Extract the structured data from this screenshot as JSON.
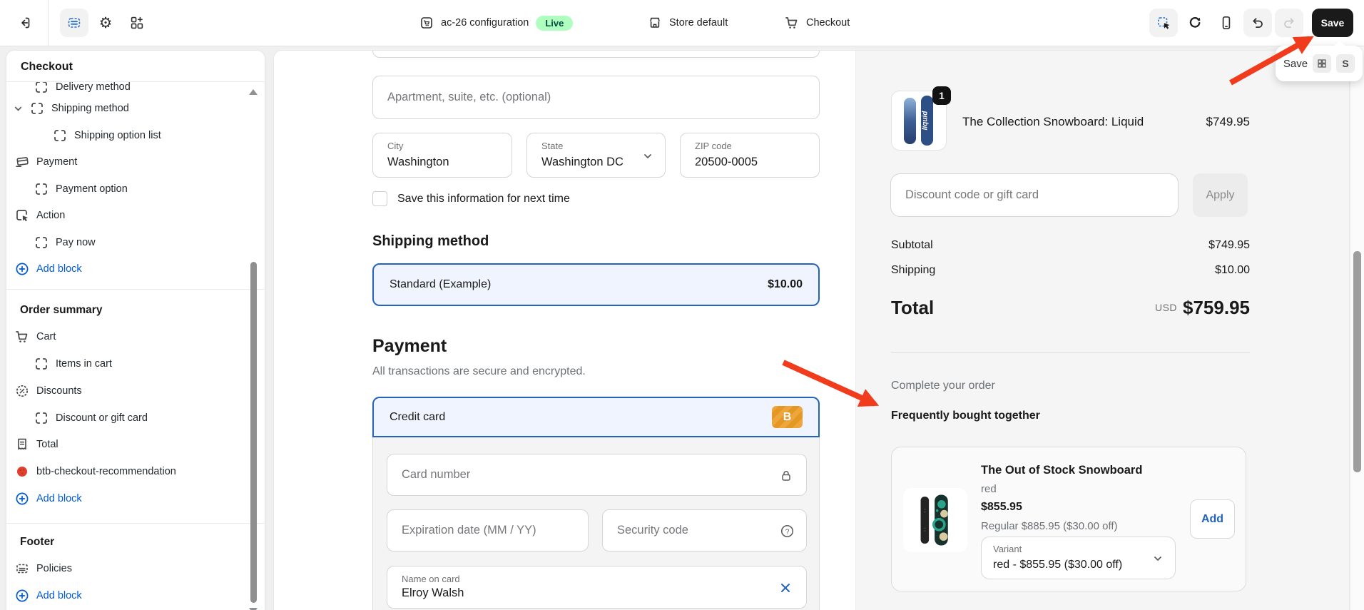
{
  "topbar": {
    "config_label": "ac-26 configuration",
    "live_badge": "Live",
    "store_label": "Store default",
    "page_label": "Checkout",
    "save_label": "Save"
  },
  "save_tooltip": {
    "label": "Save",
    "shortcut_key": "S"
  },
  "sidebar": {
    "title": "Checkout",
    "items": [
      {
        "label": "Delivery method"
      },
      {
        "label": "Shipping method"
      },
      {
        "label": "Shipping option list"
      },
      {
        "label": "Payment"
      },
      {
        "label": "Payment option"
      },
      {
        "label": "Action"
      },
      {
        "label": "Pay now"
      },
      {
        "label": "Add block"
      },
      {
        "label": "Order summary"
      },
      {
        "label": "Cart"
      },
      {
        "label": "Items in cart"
      },
      {
        "label": "Discounts"
      },
      {
        "label": "Discount or gift card"
      },
      {
        "label": "Total"
      },
      {
        "label": "btb-checkout-recommendation"
      },
      {
        "label": "Add block"
      },
      {
        "label": "Footer"
      },
      {
        "label": "Policies"
      },
      {
        "label": "Add block"
      }
    ]
  },
  "checkout_form": {
    "apartment_placeholder": "Apartment, suite, etc. (optional)",
    "city_label": "City",
    "city_value": "Washington",
    "state_label": "State",
    "state_value": "Washington DC",
    "zip_label": "ZIP code",
    "zip_value": "20500-0005",
    "save_info_label": "Save this information for next time",
    "shipping_heading": "Shipping method",
    "shipping_option_name": "Standard (Example)",
    "shipping_option_price": "$10.00",
    "payment_heading": "Payment",
    "payment_subtext": "All transactions are secure and encrypted.",
    "credit_card_label": "Credit card",
    "gateway_badge": "B",
    "card_number_placeholder": "Card number",
    "expiration_placeholder": "Expiration date (MM / YY)",
    "security_placeholder": "Security code",
    "name_on_card_label": "Name on card",
    "name_on_card_value": "Elroy Walsh"
  },
  "order_summary": {
    "item": {
      "qty": "1",
      "title": "The Collection Snowboard: Liquid",
      "price": "$749.95"
    },
    "discount_placeholder": "Discount code or gift card",
    "apply_label": "Apply",
    "subtotal_label": "Subtotal",
    "subtotal_value": "$749.95",
    "shipping_label": "Shipping",
    "shipping_value": "$10.00",
    "total_label": "Total",
    "currency": "USD",
    "total_value": "$759.95",
    "complete_label": "Complete your order",
    "fbt_heading": "Frequently bought together",
    "fbt": {
      "title": "The Out of Stock Snowboard",
      "variant": "red",
      "price": "$855.95",
      "regular": "Regular $885.95 ($30.00 off)",
      "variant_label": "Variant",
      "variant_value": "red - $855.95 ($30.00 off)",
      "add_label": "Add"
    }
  },
  "colors": {
    "admin_blue": "#005bd3",
    "checkout_blue": "#2463bc",
    "live_green_bg": "#affebf",
    "arrow_red": "#f13b1d",
    "gateway_orange": "#eda53c"
  }
}
